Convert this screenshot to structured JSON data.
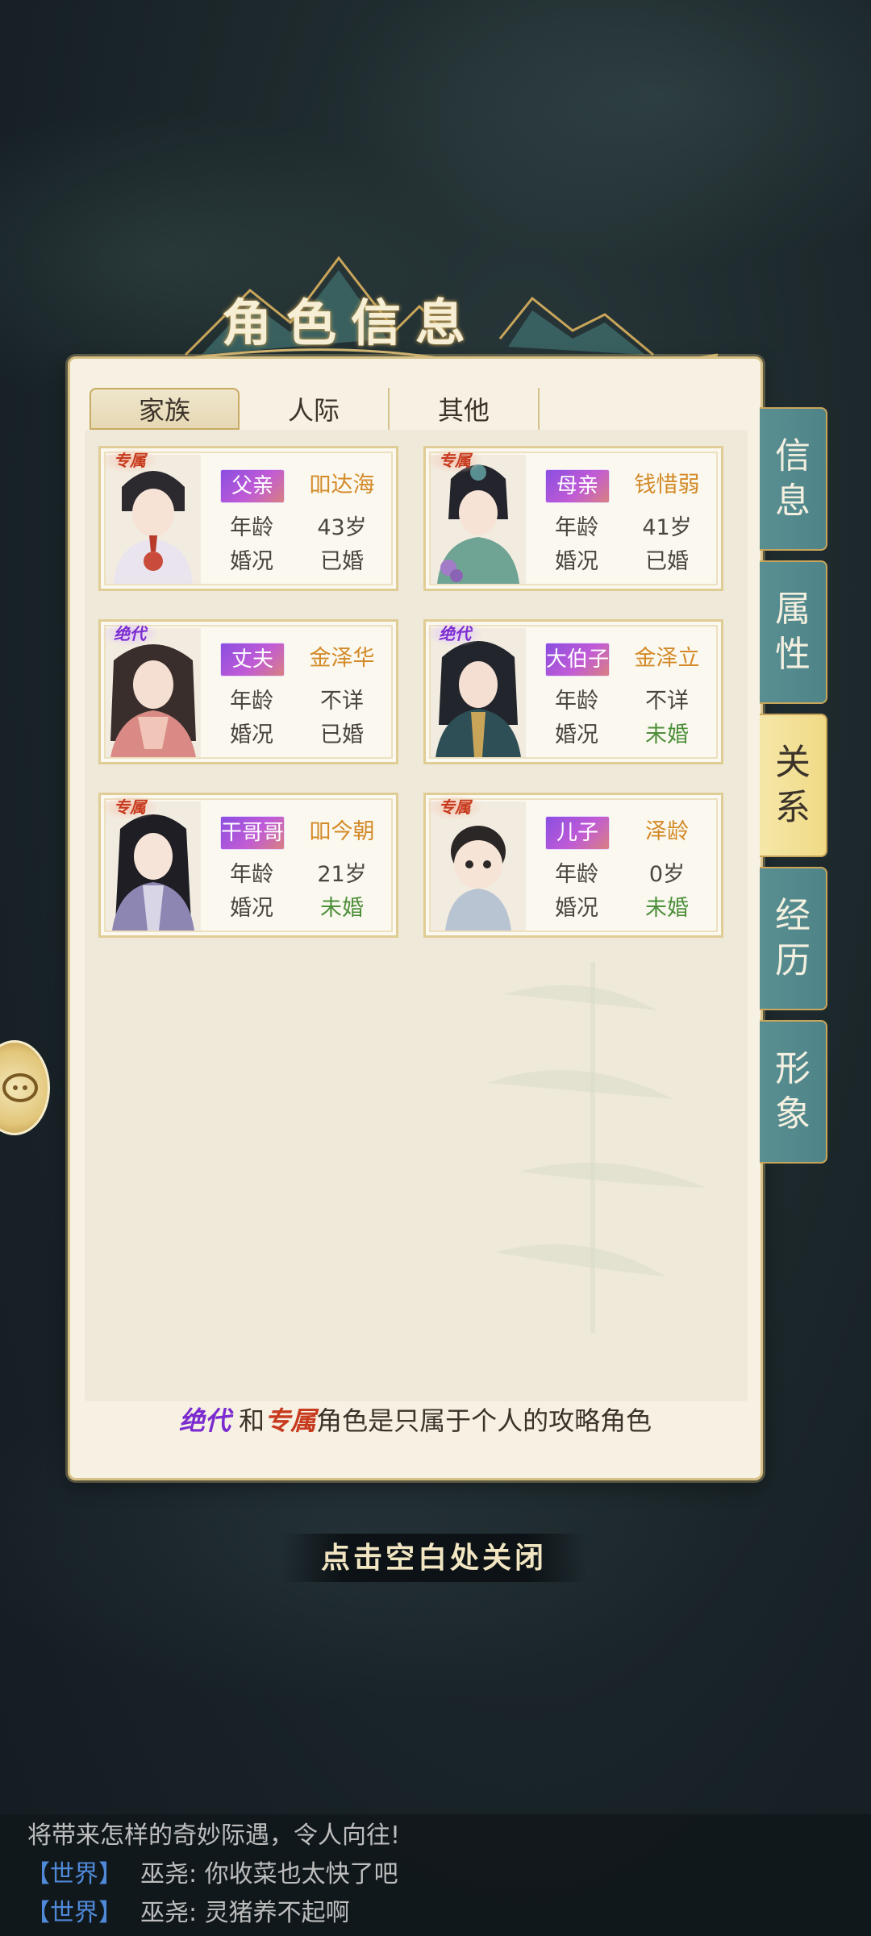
{
  "title": "角色信息",
  "tabs": [
    {
      "label": "家族",
      "active": true
    },
    {
      "label": "人际",
      "active": false
    },
    {
      "label": "其他",
      "active": false
    }
  ],
  "labels": {
    "age": "年龄",
    "marital": "婚况"
  },
  "cards": [
    {
      "badge": "专属",
      "badge_type": "zhuanshu",
      "relation": "父亲",
      "name": "吅达海",
      "age": "43岁",
      "marital": "已婚",
      "marital_status": "married"
    },
    {
      "badge": "专属",
      "badge_type": "zhuanshu",
      "relation": "母亲",
      "name": "钱惜弱",
      "age": "41岁",
      "marital": "已婚",
      "marital_status": "married"
    },
    {
      "badge": "绝代",
      "badge_type": "juedai",
      "relation": "丈夫",
      "name": "金泽华",
      "age": "不详",
      "marital": "已婚",
      "marital_status": "married"
    },
    {
      "badge": "绝代",
      "badge_type": "juedai",
      "relation": "大伯子",
      "name": "金泽立",
      "age": "不详",
      "marital": "未婚",
      "marital_status": "single"
    },
    {
      "badge": "专属",
      "badge_type": "zhuanshu",
      "relation": "干哥哥",
      "name": "吅今朝",
      "age": "21岁",
      "marital": "未婚",
      "marital_status": "single"
    },
    {
      "badge": "专属",
      "badge_type": "zhuanshu",
      "relation": "儿子",
      "name": "泽龄",
      "age": "0岁",
      "marital": "未婚",
      "marital_status": "single"
    }
  ],
  "footer_note": {
    "juedai": "绝代",
    "and": "和",
    "zhuanshu": "专属",
    "rest": "角色是只属于个人的攻略角色"
  },
  "side_tabs": [
    {
      "label": "信息",
      "active": false
    },
    {
      "label": "属性",
      "active": false
    },
    {
      "label": "关系",
      "active": true
    },
    {
      "label": "经历",
      "active": false
    },
    {
      "label": "形象",
      "active": false
    }
  ],
  "close_hint": "点击空白处关闭",
  "chat": {
    "system_line": "将带来怎样的奇妙际遇，令人向往!",
    "messages": [
      {
        "channel": "【世界】",
        "text": "巫尧: 你收菜也太快了吧"
      },
      {
        "channel": "【世界】",
        "text": "巫尧: 灵猪养不起啊"
      }
    ]
  },
  "colors": {
    "accent_gold": "#c9a55a",
    "side_tab_teal": "#5a8f92",
    "name_orange": "#d38a28",
    "single_green": "#4d8f3a"
  }
}
